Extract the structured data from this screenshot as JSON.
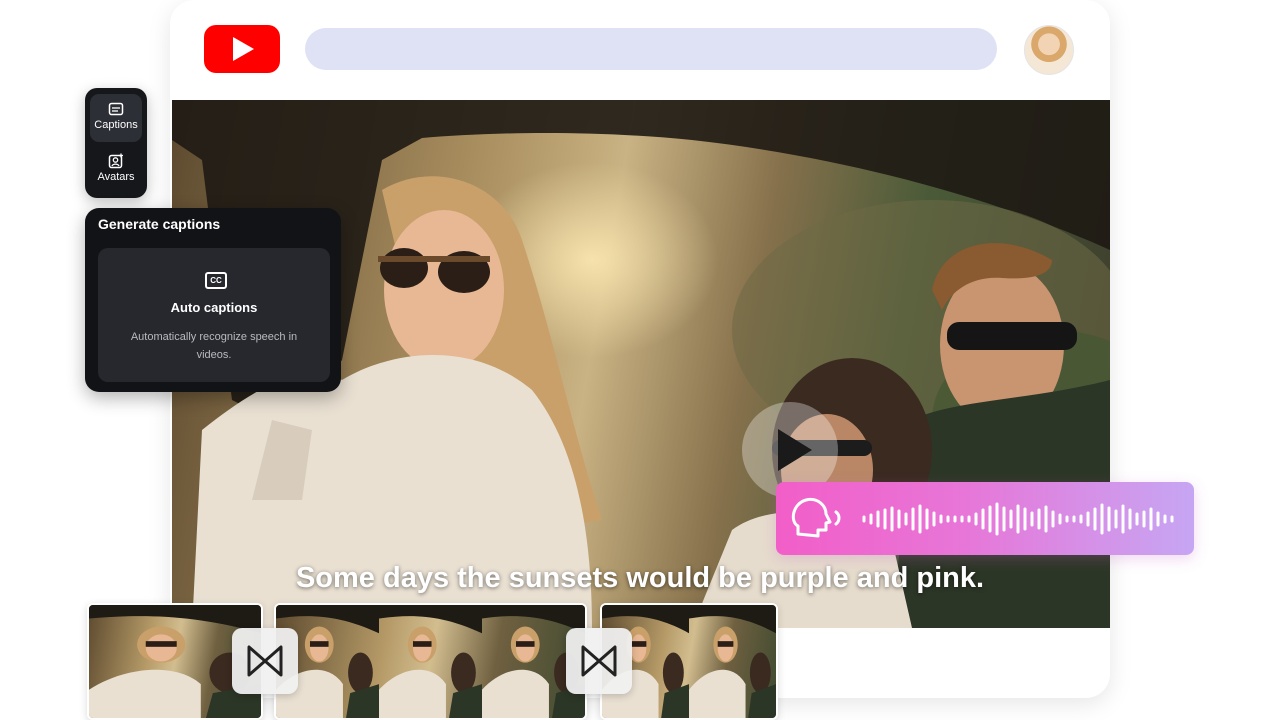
{
  "colors": {
    "youtube_red": "#ff0000",
    "search_bar": "#dfe1f5",
    "panel_bg": "#121316",
    "voice_gradient_start": "#f25ec8",
    "voice_gradient_end": "#c6a6f3"
  },
  "icons": {
    "logo": "youtube-logo-icon",
    "play": "play-icon",
    "captions": "captions-icon",
    "avatars": "avatar-add-icon",
    "auto_captions": "cc-icon",
    "voice": "speaking-head-icon",
    "transition": "transition-bowtie-icon"
  },
  "side_nav": {
    "items": [
      {
        "label": "Captions",
        "icon": "captions-icon",
        "active": true
      },
      {
        "label": "Avatars",
        "icon": "avatar-add-icon",
        "active": false
      }
    ]
  },
  "generate_panel": {
    "title": "Generate captions",
    "card": {
      "icon_text": "CC",
      "title": "Auto captions",
      "description": "Automatically recognize speech in videos."
    }
  },
  "video": {
    "subtitle": "Some days the sunsets would be purple and pink."
  }
}
